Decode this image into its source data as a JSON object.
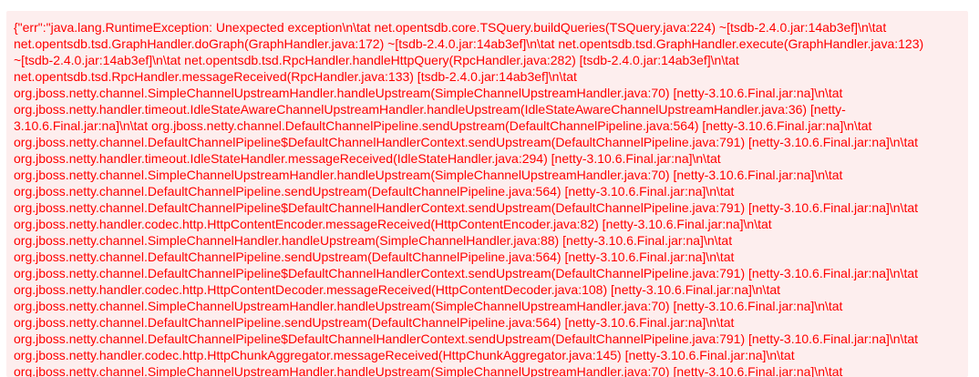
{
  "colors": {
    "panel_background": "#fdeeee",
    "error_text": "#ff0000"
  },
  "error": {
    "lines": [
      "{\"err\":\"java.lang.RuntimeException: Unexpected exception\\n\\tat net.opentsdb.core.TSQuery.buildQueries(TSQuery.java:224) ~[tsdb-2.4.0.jar:14ab3ef]\\n\\tat",
      "net.opentsdb.tsd.GraphHandler.doGraph(GraphHandler.java:172) ~[tsdb-2.4.0.jar:14ab3ef]\\n\\tat net.opentsdb.tsd.GraphHandler.execute(GraphHandler.java:123)",
      "~[tsdb-2.4.0.jar:14ab3ef]\\n\\tat net.opentsdb.tsd.RpcHandler.handleHttpQuery(RpcHandler.java:282) [tsdb-2.4.0.jar:14ab3ef]\\n\\tat",
      "net.opentsdb.tsd.RpcHandler.messageReceived(RpcHandler.java:133) [tsdb-2.4.0.jar:14ab3ef]\\n\\tat",
      "org.jboss.netty.channel.SimpleChannelUpstreamHandler.handleUpstream(SimpleChannelUpstreamHandler.java:70) [netty-3.10.6.Final.jar:na]\\n\\tat",
      "org.jboss.netty.handler.timeout.IdleStateAwareChannelUpstreamHandler.handleUpstream(IdleStateAwareChannelUpstreamHandler.java:36) [netty-",
      "3.10.6.Final.jar:na]\\n\\tat org.jboss.netty.channel.DefaultChannelPipeline.sendUpstream(DefaultChannelPipeline.java:564) [netty-3.10.6.Final.jar:na]\\n\\tat",
      "org.jboss.netty.channel.DefaultChannelPipeline$DefaultChannelHandlerContext.sendUpstream(DefaultChannelPipeline.java:791) [netty-3.10.6.Final.jar:na]\\n\\tat",
      "org.jboss.netty.handler.timeout.IdleStateHandler.messageReceived(IdleStateHandler.java:294) [netty-3.10.6.Final.jar:na]\\n\\tat",
      "org.jboss.netty.channel.SimpleChannelUpstreamHandler.handleUpstream(SimpleChannelUpstreamHandler.java:70) [netty-3.10.6.Final.jar:na]\\n\\tat",
      "org.jboss.netty.channel.DefaultChannelPipeline.sendUpstream(DefaultChannelPipeline.java:564) [netty-3.10.6.Final.jar:na]\\n\\tat",
      "org.jboss.netty.channel.DefaultChannelPipeline$DefaultChannelHandlerContext.sendUpstream(DefaultChannelPipeline.java:791) [netty-3.10.6.Final.jar:na]\\n\\tat",
      "org.jboss.netty.handler.codec.http.HttpContentEncoder.messageReceived(HttpContentEncoder.java:82) [netty-3.10.6.Final.jar:na]\\n\\tat",
      "org.jboss.netty.channel.SimpleChannelHandler.handleUpstream(SimpleChannelHandler.java:88) [netty-3.10.6.Final.jar:na]\\n\\tat",
      "org.jboss.netty.channel.DefaultChannelPipeline.sendUpstream(DefaultChannelPipeline.java:564) [netty-3.10.6.Final.jar:na]\\n\\tat",
      "org.jboss.netty.channel.DefaultChannelPipeline$DefaultChannelHandlerContext.sendUpstream(DefaultChannelPipeline.java:791) [netty-3.10.6.Final.jar:na]\\n\\tat",
      "org.jboss.netty.handler.codec.http.HttpContentDecoder.messageReceived(HttpContentDecoder.java:108) [netty-3.10.6.Final.jar:na]\\n\\tat",
      "org.jboss.netty.channel.SimpleChannelUpstreamHandler.handleUpstream(SimpleChannelUpstreamHandler.java:70) [netty-3.10.6.Final.jar:na]\\n\\tat",
      "org.jboss.netty.channel.DefaultChannelPipeline.sendUpstream(DefaultChannelPipeline.java:564) [netty-3.10.6.Final.jar:na]\\n\\tat",
      "org.jboss.netty.channel.DefaultChannelPipeline$DefaultChannelHandlerContext.sendUpstream(DefaultChannelPipeline.java:791) [netty-3.10.6.Final.jar:na]\\n\\tat",
      "org.jboss.netty.handler.codec.http.HttpChunkAggregator.messageReceived(HttpChunkAggregator.java:145) [netty-3.10.6.Final.jar:na]\\n\\tat",
      "org.jboss.netty.channel.SimpleChannelUpstreamHandler.handleUpstream(SimpleChannelUpstreamHandler.java:70) [netty-3.10.6.Final.jar:na]\\n\\tat"
    ]
  }
}
